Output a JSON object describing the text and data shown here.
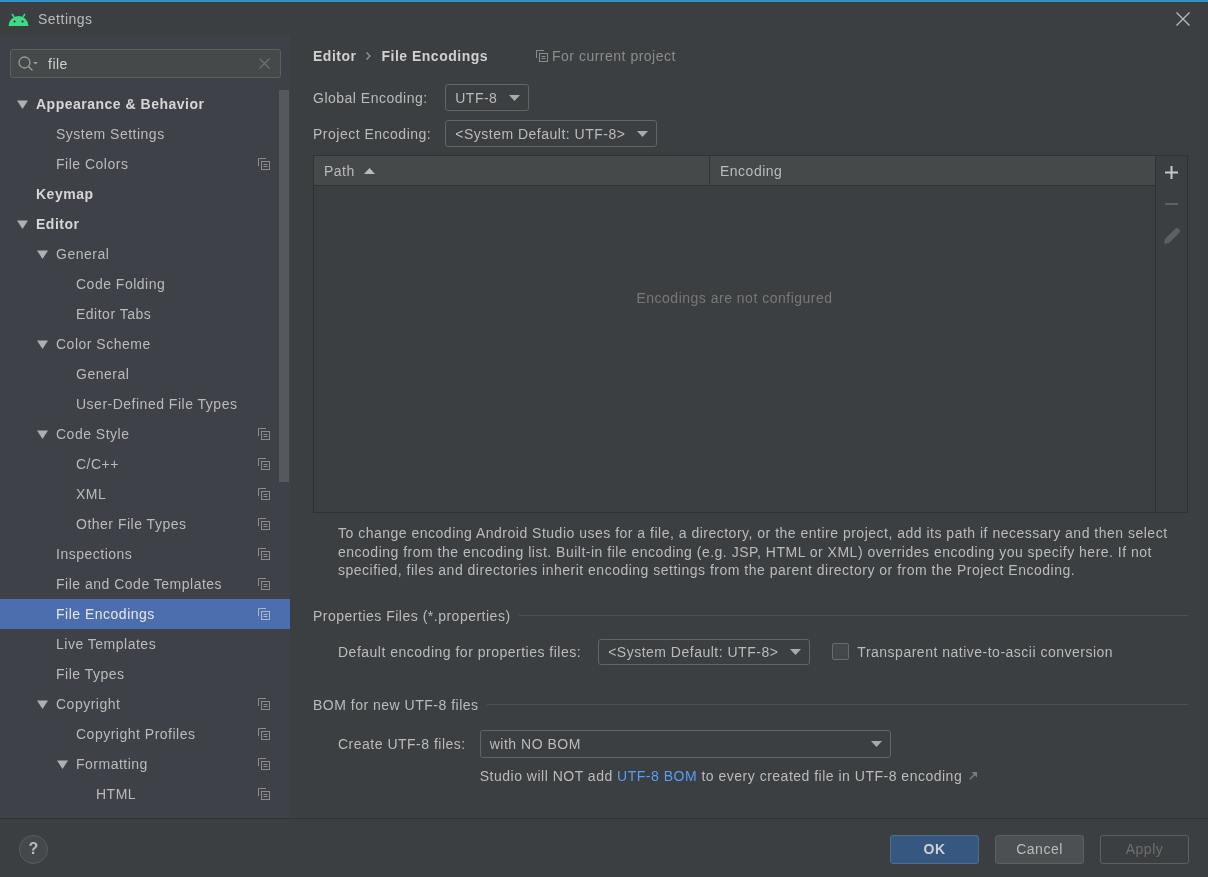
{
  "window": {
    "title": "Settings"
  },
  "search": {
    "value": "file"
  },
  "tree": [
    {
      "label": "Appearance & Behavior",
      "expanded": true,
      "selected": false,
      "project_scoped": false,
      "children": [
        {
          "label": "System Settings",
          "selected": false,
          "project_scoped": false
        },
        {
          "label": "File Colors",
          "selected": false,
          "project_scoped": true
        }
      ]
    },
    {
      "label": "Keymap",
      "selected": false,
      "project_scoped": false
    },
    {
      "label": "Editor",
      "expanded": true,
      "selected": false,
      "project_scoped": false,
      "children": [
        {
          "label": "General",
          "expanded": true,
          "selected": false,
          "project_scoped": false,
          "children": [
            {
              "label": "Code Folding",
              "selected": false,
              "project_scoped": false
            },
            {
              "label": "Editor Tabs",
              "selected": false,
              "project_scoped": false
            }
          ]
        },
        {
          "label": "Color Scheme",
          "expanded": true,
          "selected": false,
          "project_scoped": false,
          "children": [
            {
              "label": "General",
              "selected": false,
              "project_scoped": false
            },
            {
              "label": "User-Defined File Types",
              "selected": false,
              "project_scoped": false
            }
          ]
        },
        {
          "label": "Code Style",
          "expanded": true,
          "selected": false,
          "project_scoped": true,
          "children": [
            {
              "label": "C/C++",
              "selected": false,
              "project_scoped": true
            },
            {
              "label": "XML",
              "selected": false,
              "project_scoped": true
            },
            {
              "label": "Other File Types",
              "selected": false,
              "project_scoped": true
            }
          ]
        },
        {
          "label": "Inspections",
          "selected": false,
          "project_scoped": true
        },
        {
          "label": "File and Code Templates",
          "selected": false,
          "project_scoped": true
        },
        {
          "label": "File Encodings",
          "selected": true,
          "project_scoped": true
        },
        {
          "label": "Live Templates",
          "selected": false,
          "project_scoped": false
        },
        {
          "label": "File Types",
          "selected": false,
          "project_scoped": false
        },
        {
          "label": "Copyright",
          "expanded": true,
          "selected": false,
          "project_scoped": true,
          "children": [
            {
              "label": "Copyright Profiles",
              "selected": false,
              "project_scoped": true
            },
            {
              "label": "Formatting",
              "expanded": true,
              "selected": false,
              "project_scoped": true,
              "children": [
                {
                  "label": "HTML",
                  "selected": false,
                  "project_scoped": true
                }
              ]
            }
          ]
        }
      ]
    }
  ],
  "breadcrumb": [
    "Editor",
    "File Encodings"
  ],
  "scope_note": "For current project",
  "encodings": [
    {
      "label": "Global Encoding:",
      "value": "UTF-8"
    },
    {
      "label": "Project Encoding:",
      "value": "<System Default: UTF-8>"
    }
  ],
  "table": {
    "columns": [
      {
        "label": "Path",
        "sort_ascending": true
      },
      {
        "label": "Encoding"
      }
    ],
    "empty_text": "Encodings are not configured",
    "toolbar": [
      {
        "kind": "add",
        "disabled": false
      },
      {
        "kind": "remove",
        "disabled": true
      },
      {
        "kind": "edit",
        "disabled": true
      }
    ]
  },
  "description": "To change encoding Android Studio uses for a file, a directory, or the entire project, add its path if necessary and then select encoding from the encoding list. Built-in file encoding (e.g. JSP, HTML or XML) overrides encoding you specify here. If not specified, files and directories inherit encoding settings from the parent directory or from the Project Encoding.",
  "properties_section": {
    "title": "Properties Files (*.properties)",
    "default_encoding": {
      "label": "Default encoding for properties files:",
      "value": "<System Default: UTF-8>"
    },
    "native_to_ascii": {
      "label": "Transparent native-to-ascii conversion",
      "checked": false
    }
  },
  "bom_section": {
    "title": "BOM for new UTF-8 files",
    "create": {
      "label": "Create UTF-8 files:",
      "value": "with NO BOM"
    },
    "hint": {
      "before": "Studio will NOT add ",
      "link": "UTF-8 BOM",
      "after": " to every created file in UTF-8 encoding"
    }
  },
  "help": {
    "label": "?"
  },
  "buttons": [
    {
      "label": "OK",
      "kind": "primary",
      "disabled": false
    },
    {
      "label": "Cancel",
      "kind": "default",
      "disabled": false
    },
    {
      "label": "Apply",
      "kind": "default",
      "disabled": true
    }
  ]
}
